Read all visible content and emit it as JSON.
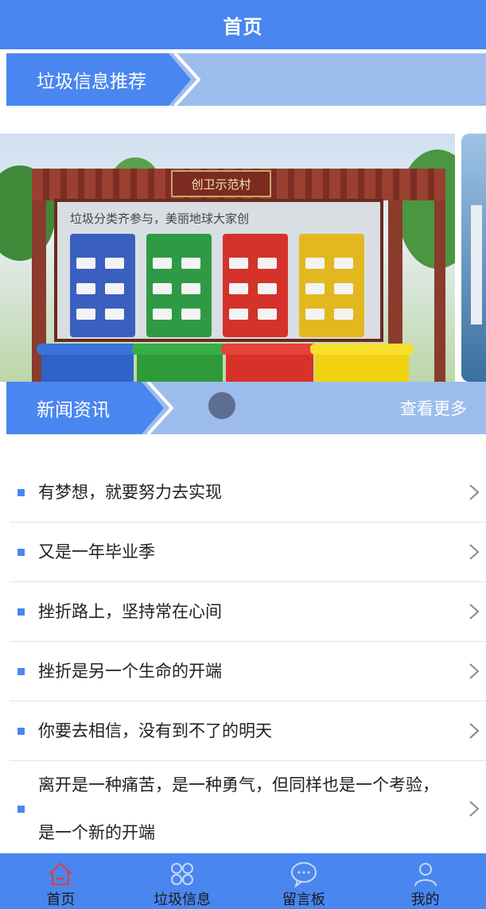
{
  "header": {
    "title": "首页"
  },
  "section_recommend": {
    "title": "垃圾信息推荐"
  },
  "carousel": {
    "slide_texts": {
      "roof_sign": "创卫示范村",
      "board_heading": "垃圾分类齐参与，美丽地球大家创"
    },
    "bin_colors": [
      "#2f63c7",
      "#2e9b3a",
      "#d8312a",
      "#f1d210"
    ]
  },
  "section_news": {
    "title": "新闻资讯",
    "more_label": "查看更多"
  },
  "news": [
    {
      "title": "有梦想，就要努力去实现"
    },
    {
      "title": "又是一年毕业季"
    },
    {
      "title": "挫折路上，坚持常在心间"
    },
    {
      "title": "挫折是另一个生命的开端"
    },
    {
      "title": "你要去相信，没有到不了的明天"
    },
    {
      "title": "离开是一种痛苦，是一种勇气，但同样也是一个考验，是一个新的开端"
    }
  ],
  "tabbar": {
    "items": [
      {
        "label": "首页",
        "icon": "home-icon",
        "active": true
      },
      {
        "label": "垃圾信息",
        "icon": "grid-icon",
        "active": false
      },
      {
        "label": "留言板",
        "icon": "chat-bubble-icon",
        "active": false
      },
      {
        "label": "我的",
        "icon": "user-icon",
        "active": false
      }
    ]
  },
  "colors": {
    "primary": "#4a86f0",
    "banner_light": "#9dbcee",
    "active_icon": "#d94040"
  }
}
